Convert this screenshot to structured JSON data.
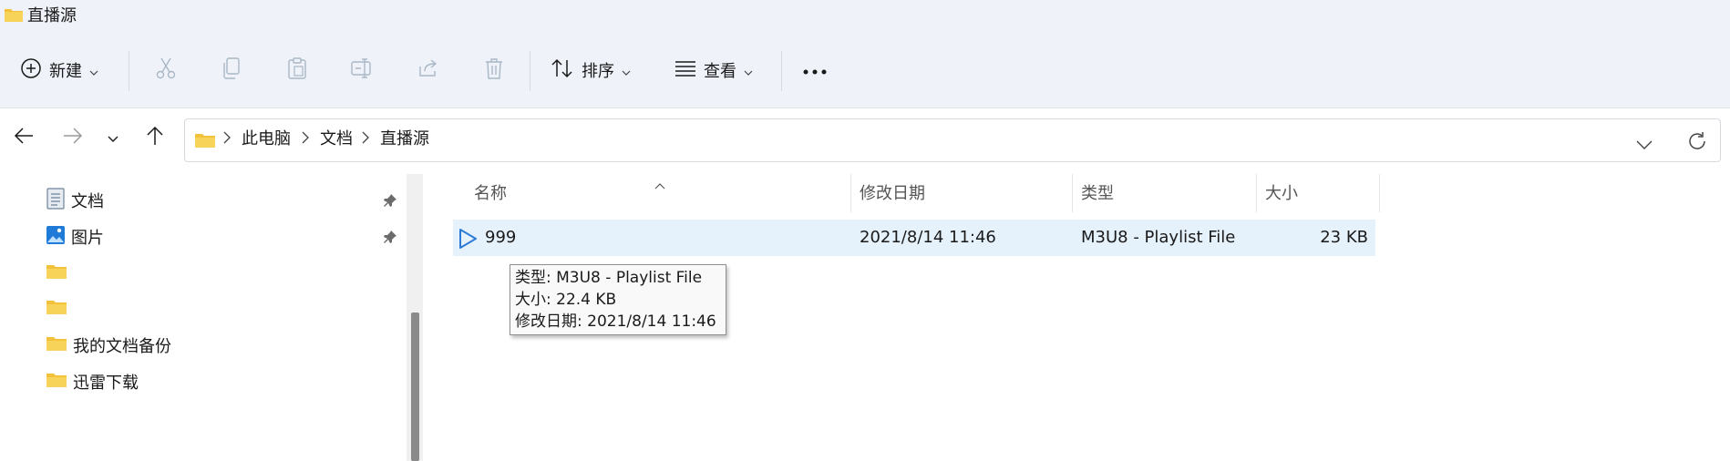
{
  "window": {
    "title": "直播源"
  },
  "toolbar": {
    "new_label": "新建",
    "sort_label": "排序",
    "view_label": "查看"
  },
  "breadcrumb": {
    "items": [
      "此电脑",
      "文档",
      "直播源"
    ]
  },
  "sidebar": {
    "items": [
      {
        "label": "文档",
        "icon": "documents-icon",
        "pinned": true
      },
      {
        "label": "图片",
        "icon": "pictures-icon",
        "pinned": true
      },
      {
        "label": "",
        "icon": "folder-icon",
        "pinned": false
      },
      {
        "label": "",
        "icon": "folder-icon",
        "pinned": false
      },
      {
        "label": "我的文档备份",
        "icon": "folder-icon",
        "pinned": false
      },
      {
        "label": "迅雷下载",
        "icon": "folder-icon",
        "pinned": false
      }
    ]
  },
  "table": {
    "columns": [
      "名称",
      "修改日期",
      "类型",
      "大小"
    ],
    "rows": [
      {
        "name": "999",
        "modified": "2021/8/14 11:46",
        "type": "M3U8 - Playlist File",
        "size": "23 KB"
      }
    ]
  },
  "tooltip": {
    "type": "类型: M3U8 - Playlist File",
    "size": "大小: 22.4 KB",
    "modified": "修改日期: 2021/8/14 11:46"
  },
  "colors": {
    "accent": "#2b7bd6",
    "selection": "#e5f1fb",
    "folder": "#f3c13a",
    "chrome": "#eff3f9"
  }
}
